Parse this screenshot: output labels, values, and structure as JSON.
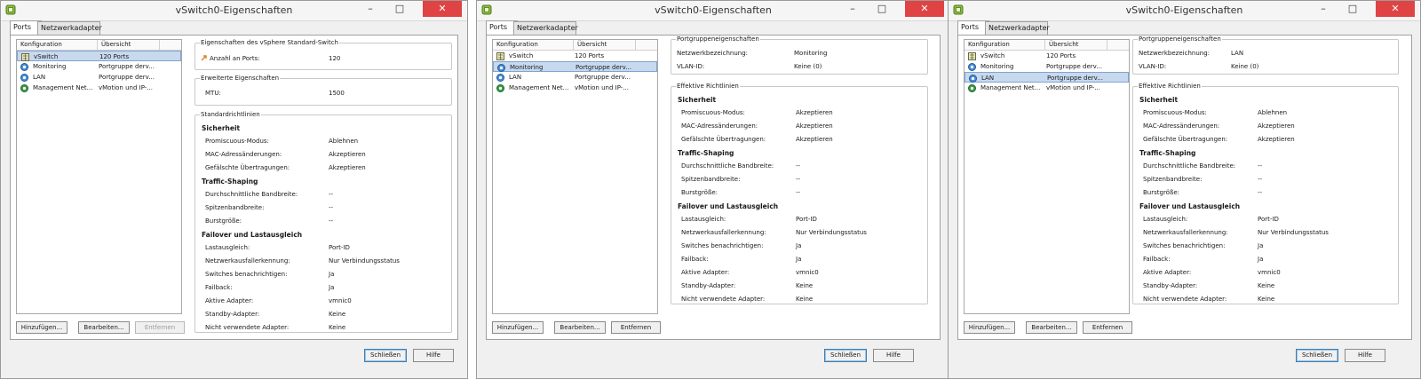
{
  "dialog": {
    "title": "vSwitch0-Eigenschaften",
    "tabs": [
      "Ports",
      "Netzwerkadapter"
    ],
    "list_columns": [
      "Konfiguration",
      "Übersicht"
    ],
    "list_items": [
      {
        "name": "vSwitch",
        "summary": "120 Ports",
        "icon": "vswitch-icon"
      },
      {
        "name": "Monitoring",
        "summary": "Portgruppe derv...",
        "icon": "portgroup-icon"
      },
      {
        "name": "LAN",
        "summary": "Portgruppe derv...",
        "icon": "portgroup-icon"
      },
      {
        "name": "Management Net...",
        "summary": "vMotion und IP-...",
        "icon": "vmkernel-icon"
      }
    ],
    "buttons": {
      "add": "Hinzufügen...",
      "edit": "Bearbeiten...",
      "remove": "Entfernen",
      "close": "Schließen",
      "help": "Hilfe"
    },
    "window_controls": {
      "minimize": "–",
      "maximize": "□",
      "close": "✕"
    }
  },
  "panel_vswitch": {
    "props_title": "Eigenschaften des vSphere Standard-Switch",
    "ports_label": "Anzahl an Ports:",
    "ports_value": "120",
    "advanced_title": "Erweiterte Eigenschaften",
    "mtu_label": "MTU:",
    "mtu_value": "1500",
    "policies_title": "Standardrichtlinien"
  },
  "panel_portgroup": {
    "props_title": "Portgruppeneigenschaften",
    "network_label": "Netzwerkbezeichnung:",
    "vlan_label": "VLAN-ID:",
    "vlan_value": "Keine (0)",
    "effective_title": "Effektive Richtlinien"
  },
  "policies": {
    "security_heading": "Sicherheit",
    "promiscuous": "Promiscuous-Modus:",
    "mac_changes": "MAC-Adressänderungen:",
    "forged": "Gefälschte Übertragungen:",
    "shaping_heading": "Traffic-Shaping",
    "avg_bw": "Durchschnittliche Bandbreite:",
    "peak_bw": "Spitzenbandbreite:",
    "burst": "Burstgröße:",
    "failover_heading": "Failover und Lastausgleich",
    "lb": "Lastausgleich:",
    "detection": "Netzwerkausfallerkennung:",
    "notify": "Switches benachrichtigen:",
    "failback": "Failback:",
    "active": "Aktive Adapter:",
    "standby": "Standby-Adapter:",
    "unused": "Nicht verwendete Adapter:"
  },
  "windows": [
    {
      "selected_item": 0,
      "promiscuous_value": "Ablehnen",
      "mac_value": "Akzeptieren",
      "forged_value": "Akzeptieren",
      "avg_value": "--",
      "peak_value": "--",
      "burst_value": "--",
      "lb_value": "Port-ID",
      "detection_value": "Nur Verbindungsstatus",
      "notify_value": "Ja",
      "failback_value": "Ja",
      "active_value": "vmnic0",
      "standby_value": "Keine",
      "unused_value": "Keine"
    },
    {
      "selected_item": 1,
      "network_value": "Monitoring",
      "promiscuous_value": "Akzeptieren",
      "mac_value": "Akzeptieren",
      "forged_value": "Akzeptieren",
      "avg_value": "--",
      "peak_value": "--",
      "burst_value": "--",
      "lb_value": "Port-ID",
      "detection_value": "Nur Verbindungsstatus",
      "notify_value": "Ja",
      "failback_value": "Ja",
      "active_value": "vmnic0",
      "standby_value": "Keine",
      "unused_value": "Keine"
    },
    {
      "selected_item": 2,
      "network_value": "LAN",
      "promiscuous_value": "Ablehnen",
      "mac_value": "Akzeptieren",
      "forged_value": "Akzeptieren",
      "avg_value": "--",
      "peak_value": "--",
      "burst_value": "--",
      "lb_value": "Port-ID",
      "detection_value": "Nur Verbindungsstatus",
      "notify_value": "Ja",
      "failback_value": "Ja",
      "active_value": "vmnic0",
      "standby_value": "Keine",
      "unused_value": "Keine"
    }
  ],
  "colors": {
    "selection": "#c7d9ef",
    "close_button": "#e04343"
  }
}
